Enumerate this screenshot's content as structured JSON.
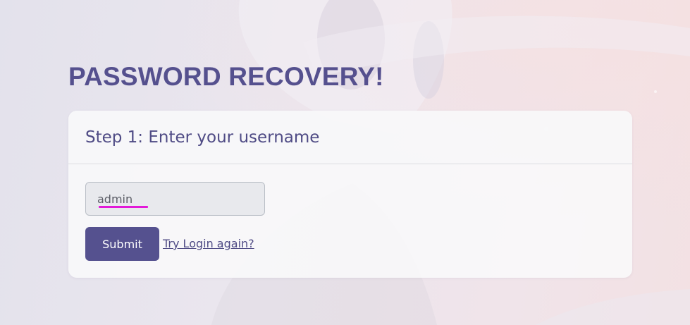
{
  "page": {
    "title": "PASSWORD RECOVERY!"
  },
  "card": {
    "heading": "Step 1: Enter your username"
  },
  "form": {
    "username_value": "admin",
    "submit_label": "Submit",
    "login_link_label": "Try Login again?"
  },
  "colors": {
    "accent": "#55518f",
    "title_text": "#55508e",
    "spellcheck_underline": "#e21ad8"
  }
}
